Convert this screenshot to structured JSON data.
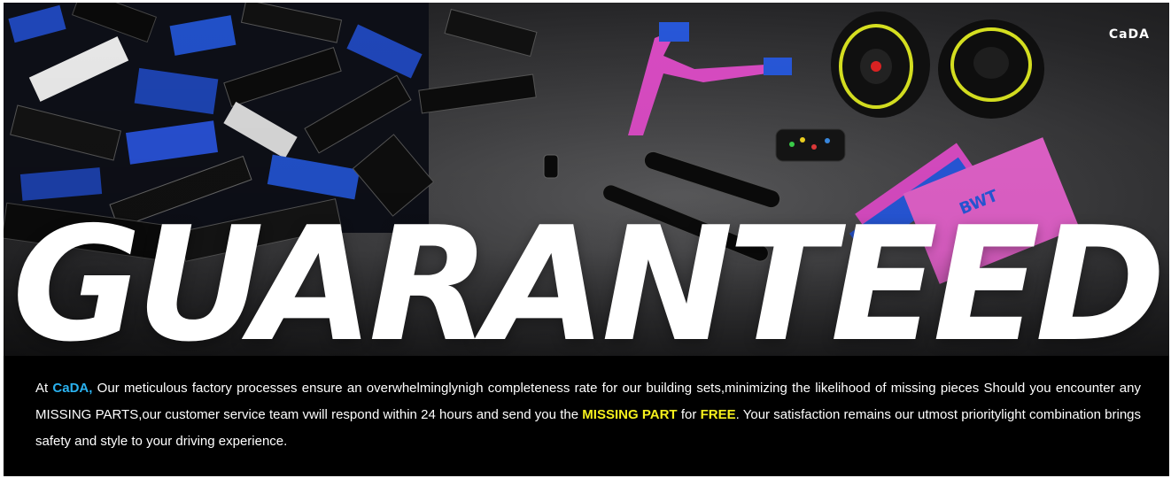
{
  "brand_logo": "CaDA",
  "headline": "GUARANTEED",
  "copy": {
    "intro": "At ",
    "brand": "CaDA,",
    "p1": " Our meticulous factory processes ensure an overwhelminglynigh completeness rate for our building sets,minimizing the likelihood of missing pieces Should you encounter any MISSING PARTS,our customer service team vwill respond within 24 hours and send you the ",
    "missing_part": "MISSING PART",
    "p2": " for ",
    "free": "FREE",
    "p3": ". Your satisfaction remains our utmost prioritylight combination brings safety and style to your driving experience."
  },
  "colors": {
    "brand_highlight": "#2ab2f0",
    "offer_highlight": "#f5f01d",
    "background": "#000000",
    "text": "#ffffff"
  }
}
